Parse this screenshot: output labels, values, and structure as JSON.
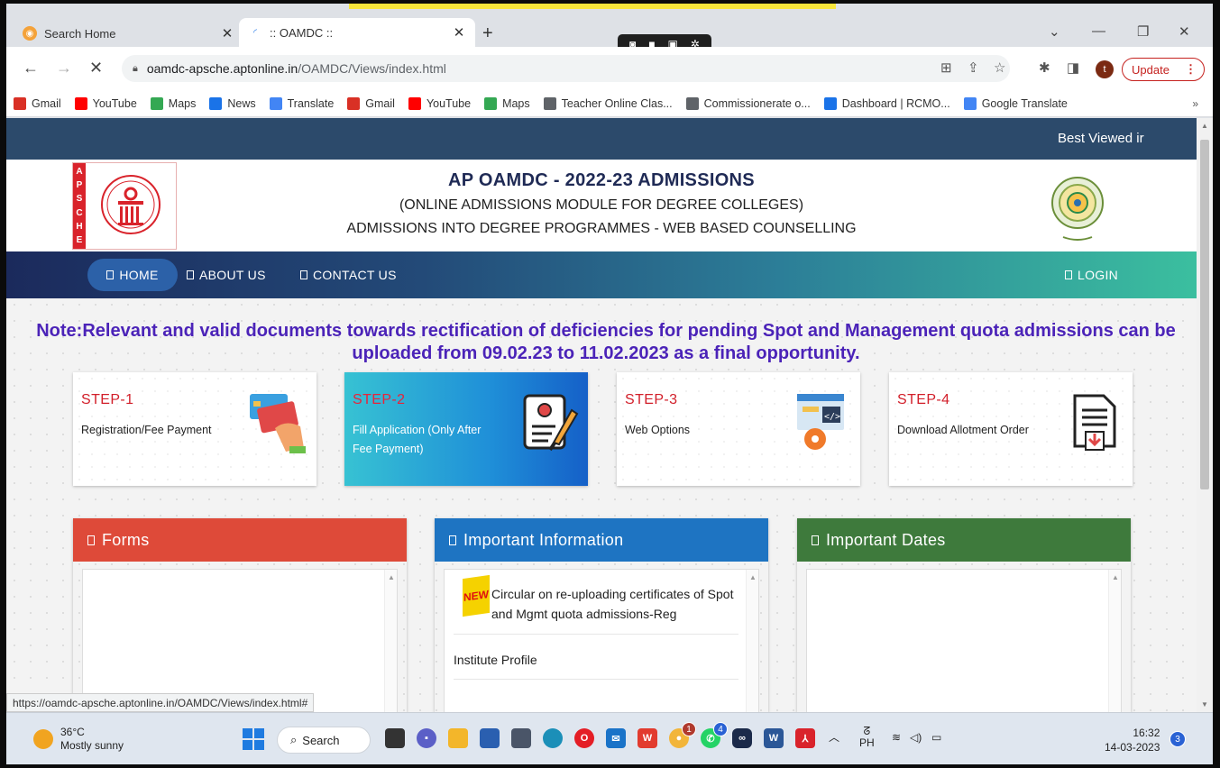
{
  "browser": {
    "tabs": [
      {
        "title": "Search Home"
      },
      {
        "title": ":: OAMDC ::"
      }
    ],
    "url_host": "oamdc-apsche.aptonline.in",
    "url_path": "/OAMDC/Views/index.html",
    "update_label": "Update",
    "profile_initial": "t",
    "bookmarks": [
      {
        "label": "Gmail",
        "icon": "gmail-icon",
        "color": "#d93025"
      },
      {
        "label": "YouTube",
        "icon": "youtube-icon",
        "color": "#ff0000"
      },
      {
        "label": "Maps",
        "icon": "maps-icon",
        "color": "#34a853"
      },
      {
        "label": "News",
        "icon": "news-icon",
        "color": "#1a73e8"
      },
      {
        "label": "Translate",
        "icon": "translate-icon",
        "color": "#4285f4"
      },
      {
        "label": "Gmail",
        "icon": "gmail-icon",
        "color": "#d93025"
      },
      {
        "label": "YouTube",
        "icon": "youtube-icon",
        "color": "#ff0000"
      },
      {
        "label": "Maps",
        "icon": "maps-icon",
        "color": "#34a853"
      },
      {
        "label": "Teacher Online Clas...",
        "icon": "globe-icon",
        "color": "#5f6368"
      },
      {
        "label": "Commissionerate o...",
        "icon": "globe-icon",
        "color": "#5f6368"
      },
      {
        "label": "Dashboard | RCMO...",
        "icon": "dashboard-icon",
        "color": "#1a73e8"
      },
      {
        "label": "Google Translate",
        "icon": "translate-icon",
        "color": "#4285f4"
      }
    ],
    "bookmarks_more": "»",
    "status_url": "https://oamdc-apsche.aptonline.in/OAMDC/Views/index.html#"
  },
  "page": {
    "topbar_text": "Best Viewed ir",
    "logo_letters": [
      "A",
      "P",
      "S",
      "C",
      "H",
      "E"
    ],
    "header": {
      "title": "AP OAMDC - 2022-23 ADMISSIONS",
      "subtitle1": "(ONLINE ADMISSIONS MODULE FOR DEGREE COLLEGES)",
      "subtitle2": "ADMISSIONS INTO DEGREE PROGRAMMES - WEB BASED COUNSELLING"
    },
    "nav": {
      "home": "HOME",
      "about": "ABOUT US",
      "contact": "CONTACT US",
      "login": "LOGIN"
    },
    "note": "Note:Relevant and valid documents towards rectification of deficiencies for pending Spot and Management quota admissions can be uploaded from 09.02.23 to 11.02.2023 as a final opportunity.",
    "steps": [
      {
        "name": "STEP-1",
        "desc": "Registration/Fee Payment",
        "icon": "credit-card-icon"
      },
      {
        "name": "STEP-2",
        "desc": "Fill Application (Only After Fee Payment)",
        "icon": "application-form-icon"
      },
      {
        "name": "STEP-3",
        "desc": "Web Options",
        "icon": "web-settings-icon"
      },
      {
        "name": "STEP-4",
        "desc": "Download Allotment Order",
        "icon": "download-document-icon"
      }
    ],
    "panels": {
      "forms": {
        "title": "Forms",
        "color": "#de4a39"
      },
      "info": {
        "title": "Important Information",
        "color": "#1e74c2",
        "new_badge": "NEW",
        "items": [
          "Circular on re-uploading certificates of Spot and Mgmt quota admissions-Reg",
          "Institute Profile"
        ]
      },
      "dates": {
        "title": "Important Dates",
        "color": "#3e7a3c"
      }
    }
  },
  "taskbar": {
    "temperature": "36°C",
    "weather": "Mostly sunny",
    "search_label": "Search",
    "whatsapp_badge": "4",
    "chrome_badge": "1",
    "lang_top": "ᘔ",
    "lang": "PH",
    "time": "16:32",
    "date": "14-03-2023",
    "notification_count": "3"
  }
}
